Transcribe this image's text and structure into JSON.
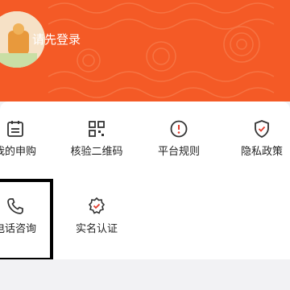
{
  "header": {
    "login_prompt": "请先登录",
    "accent": "#f45a26"
  },
  "services": {
    "row1": [
      {
        "label": "我的申购",
        "icon": "calendar-icon"
      },
      {
        "label": "核验二维码",
        "icon": "qr-code-icon"
      },
      {
        "label": "平台规则",
        "icon": "exclamation-icon"
      },
      {
        "label": "隐私政策",
        "icon": "shield-check-icon"
      }
    ],
    "row2": [
      {
        "label": "电话咨询",
        "icon": "phone-icon"
      },
      {
        "label": "实名认证",
        "icon": "verified-badge-icon"
      }
    ]
  }
}
